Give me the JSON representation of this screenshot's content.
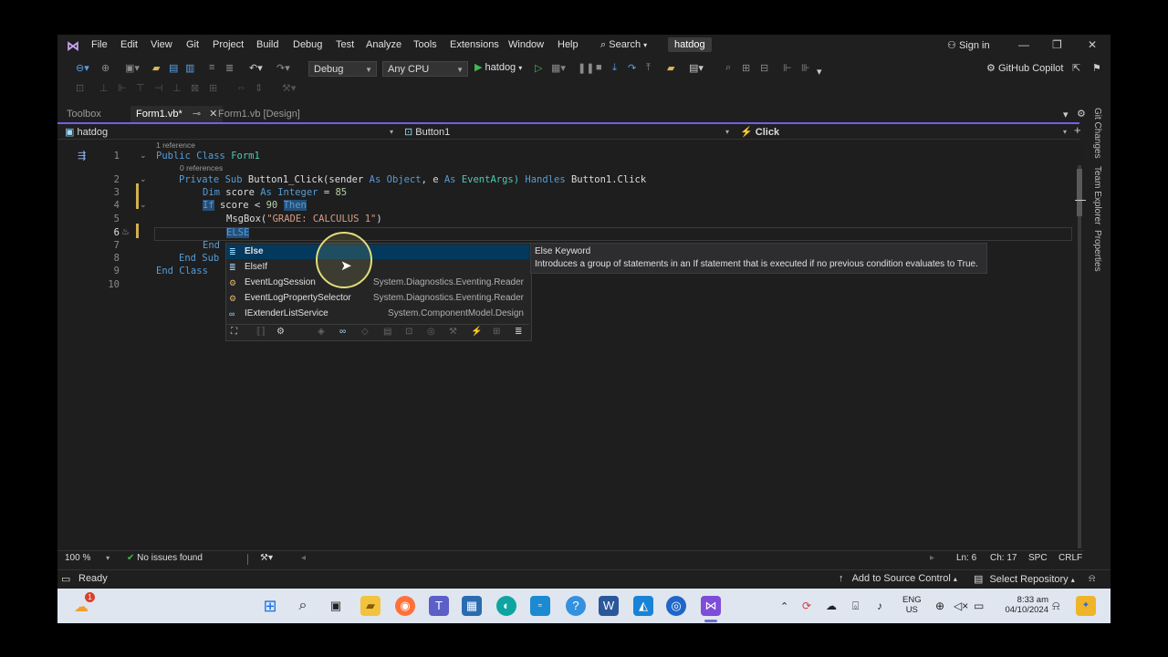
{
  "menubar": {
    "items": [
      "File",
      "Edit",
      "View",
      "Git",
      "Project",
      "Build",
      "Debug",
      "Test",
      "Analyze",
      "Tools",
      "Extensions",
      "Window",
      "Help"
    ],
    "search_label": "Search",
    "solution_name": "hatdog",
    "sign_in": "Sign in"
  },
  "toolbar": {
    "configuration": "Debug",
    "platform": "Any CPU",
    "run_target": "hatdog",
    "copilot": "GitHub Copilot"
  },
  "tabs": {
    "toolbox": "Toolbox",
    "active": "Form1.vb*",
    "design": "Form1.vb [Design]"
  },
  "navbar": {
    "project": "hatdog",
    "object": "Button1",
    "member": "Click"
  },
  "code": {
    "line_numbers": [
      "1",
      "2",
      "3",
      "4",
      "5",
      "6",
      "7",
      "8",
      "9",
      "10"
    ],
    "ref_hint_1": "1 reference",
    "ref_hint_2": "0 references",
    "l1_kw": "Public Class",
    "l1_name": "Form1",
    "l2_kw": "Private Sub",
    "l2_name": "Button1_Click(sender",
    "l2_as1": "As",
    "l2_type1": "Object",
    "l2_e": ", e",
    "l2_as2": "As",
    "l2_type2": "EventArgs)",
    "l2_handles": "Handles",
    "l2_tail": "Button1.Click",
    "l3_dim": "Dim",
    "l3_var": "score",
    "l3_as": "As",
    "l3_type": "Integer",
    "l3_eq": "=",
    "l3_val": "85",
    "l4_if": "If",
    "l4_var": "score <",
    "l4_val": "90",
    "l4_then": "Then",
    "l5_fn": "MsgBox(",
    "l5_str": "\"GRADE: CALCULUS 1\"",
    "l5_end": ")",
    "l6_text": "ELSE",
    "l7_text": "End",
    "l8_text": "End Sub",
    "l9_text": "End Class"
  },
  "completion": {
    "items": [
      {
        "label": "Else",
        "ns": ""
      },
      {
        "label": "ElseIf",
        "ns": ""
      },
      {
        "label": "EventLogSession",
        "ns": "System.Diagnostics.Eventing.Reader"
      },
      {
        "label": "EventLogPropertySelector",
        "ns": "System.Diagnostics.Eventing.Reader"
      },
      {
        "label": "IExtenderListService",
        "ns": "System.ComponentModel.Design"
      }
    ],
    "tooltip_title": "Else Keyword",
    "tooltip_desc": "Introduces a group of statements in an If statement that is executed if no previous condition evaluates to True."
  },
  "side_panel": {
    "git_changes": "Git Changes",
    "team_explorer": "Team Explorer",
    "properties": "Properties"
  },
  "editor_status": {
    "zoom": "100 %",
    "issues": "No issues found",
    "line": "Ln: 6",
    "col": "Ch: 17",
    "whitespace": "SPC",
    "eol": "CRLF"
  },
  "statusbar": {
    "ready": "Ready",
    "source_control": "Add to Source Control",
    "repository": "Select Repository"
  },
  "taskbar": {
    "lang_top": "ENG",
    "lang_bottom": "US",
    "time": "8:33 am",
    "date": "04/10/2024",
    "weather_badge": "1"
  },
  "colors": {
    "accent": "#7160e8",
    "keyword": "#569cd6",
    "type": "#4ec9b0",
    "string": "#d69d85",
    "number": "#b5cea8",
    "selection": "#04395e"
  }
}
